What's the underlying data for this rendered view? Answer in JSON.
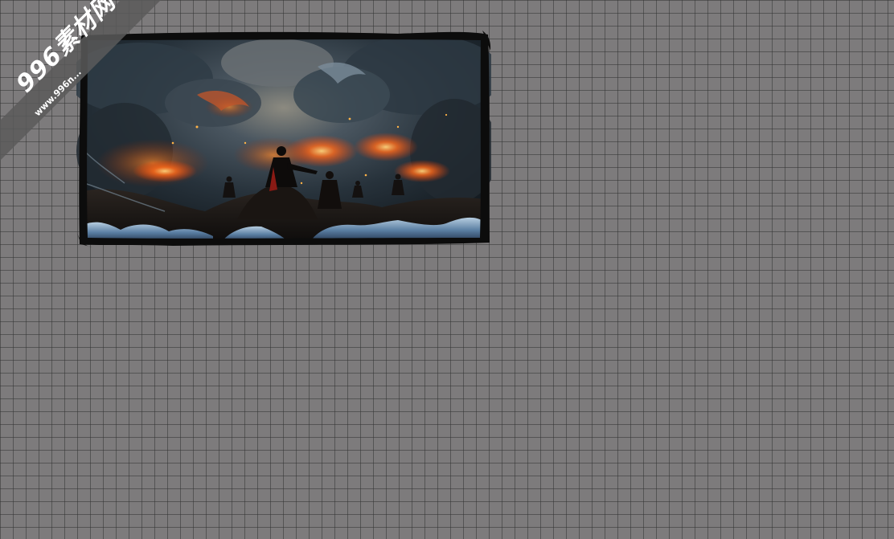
{
  "canvas": {
    "background_color": "#7d7b7c",
    "grid_color": "#343434"
  },
  "watermark": {
    "main_text": "996素材网",
    "url_text": "www.996n..."
  },
  "sprite": {
    "description_icon": "battle-scene-image",
    "palette": {
      "sky_dark": "#1b252d",
      "smoke": "#3d4b55",
      "fire": "#ff6a1a",
      "ember": "#ffb347",
      "ice": "#6f93b5",
      "frame": "#0c0c0c"
    }
  }
}
